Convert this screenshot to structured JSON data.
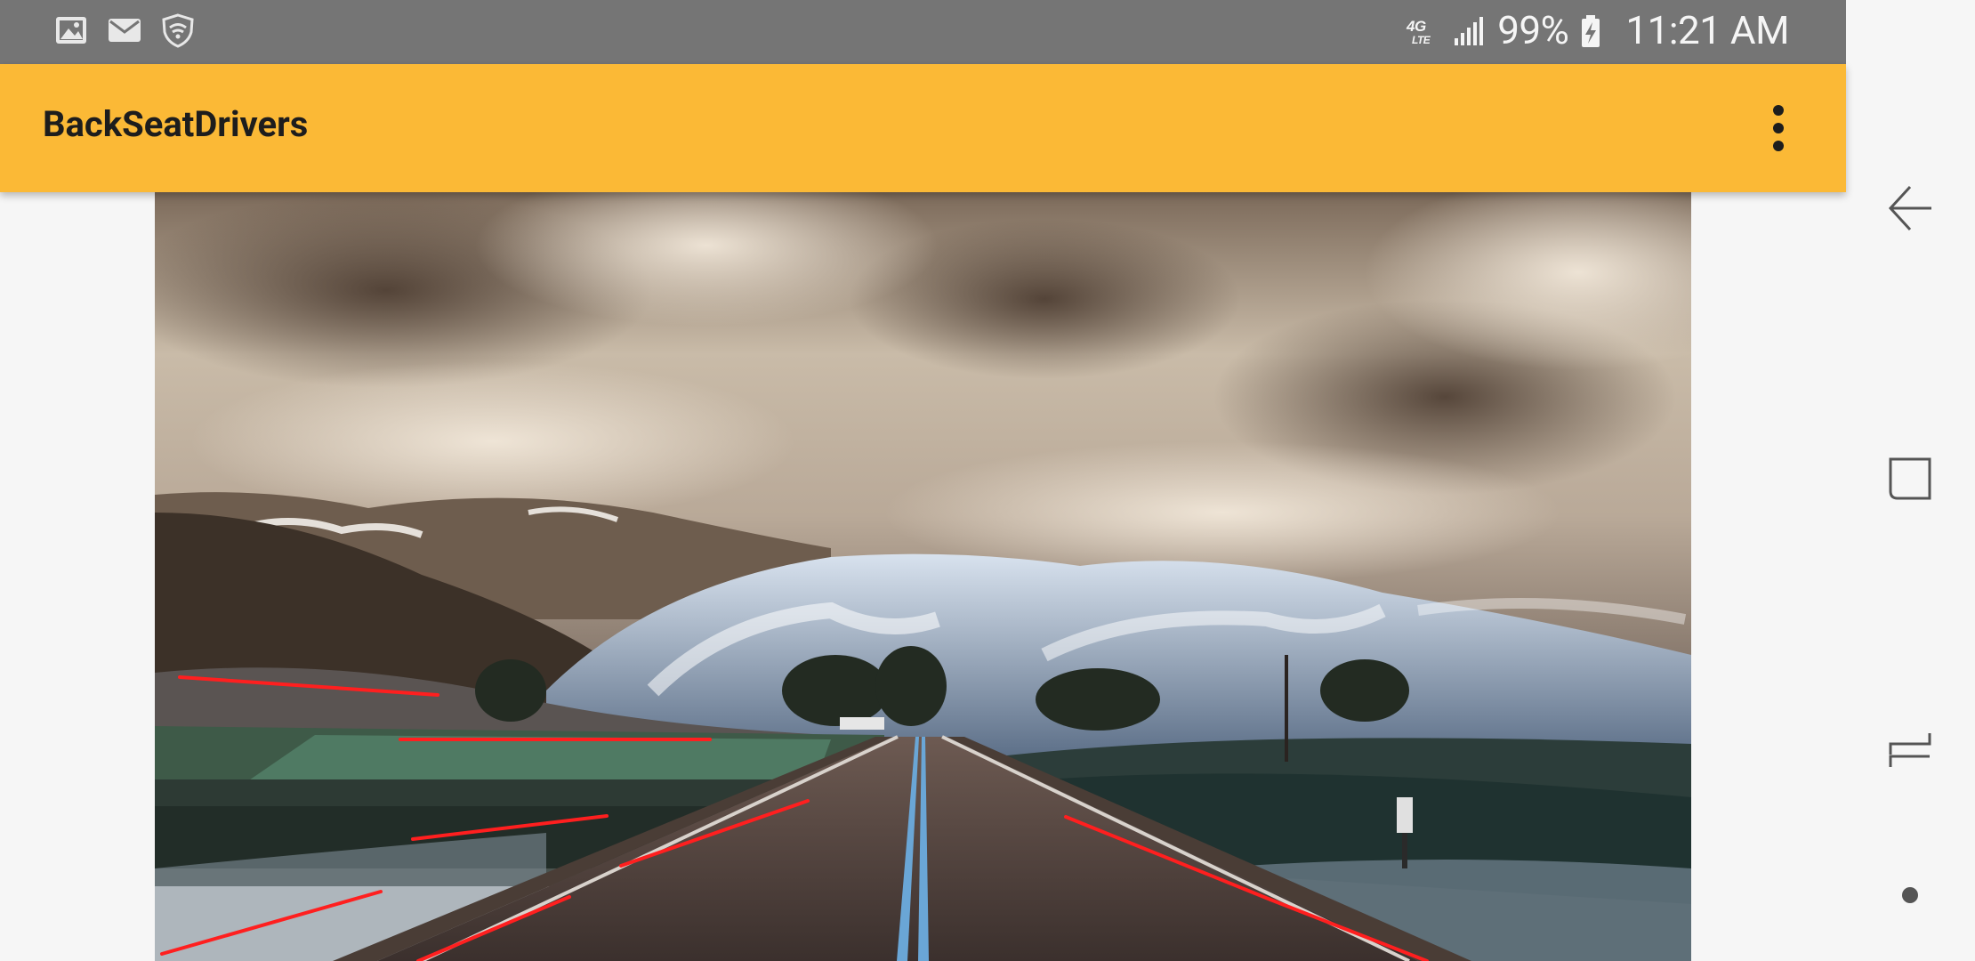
{
  "status_bar": {
    "icons_left": [
      "gallery-icon",
      "mail-icon",
      "wifi-shield-icon"
    ],
    "network": "4G LTE",
    "battery": "99%",
    "time": "11:21 AM"
  },
  "app_bar": {
    "title": "BackSeatDrivers",
    "menu_icon": "more-vert-icon"
  },
  "nav_bar": {
    "buttons": [
      "back-icon",
      "recents-icon",
      "overview-icon",
      "home-dot-icon"
    ]
  },
  "colors": {
    "app_bar": "#fbb936",
    "status_bar": "#757575",
    "lane_overlay": "#ff2020"
  }
}
